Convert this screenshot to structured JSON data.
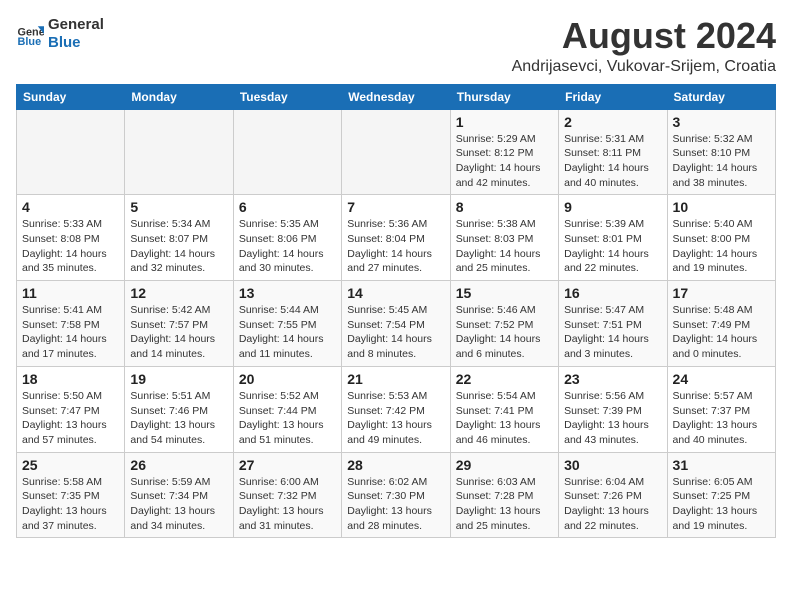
{
  "logo": {
    "line1": "General",
    "line2": "Blue"
  },
  "title": "August 2024",
  "subtitle": "Andrijasevci, Vukovar-Srijem, Croatia",
  "days_of_week": [
    "Sunday",
    "Monday",
    "Tuesday",
    "Wednesday",
    "Thursday",
    "Friday",
    "Saturday"
  ],
  "weeks": [
    [
      {
        "day": "",
        "info": ""
      },
      {
        "day": "",
        "info": ""
      },
      {
        "day": "",
        "info": ""
      },
      {
        "day": "",
        "info": ""
      },
      {
        "day": "1",
        "info": "Sunrise: 5:29 AM\nSunset: 8:12 PM\nDaylight: 14 hours\nand 42 minutes."
      },
      {
        "day": "2",
        "info": "Sunrise: 5:31 AM\nSunset: 8:11 PM\nDaylight: 14 hours\nand 40 minutes."
      },
      {
        "day": "3",
        "info": "Sunrise: 5:32 AM\nSunset: 8:10 PM\nDaylight: 14 hours\nand 38 minutes."
      }
    ],
    [
      {
        "day": "4",
        "info": "Sunrise: 5:33 AM\nSunset: 8:08 PM\nDaylight: 14 hours\nand 35 minutes."
      },
      {
        "day": "5",
        "info": "Sunrise: 5:34 AM\nSunset: 8:07 PM\nDaylight: 14 hours\nand 32 minutes."
      },
      {
        "day": "6",
        "info": "Sunrise: 5:35 AM\nSunset: 8:06 PM\nDaylight: 14 hours\nand 30 minutes."
      },
      {
        "day": "7",
        "info": "Sunrise: 5:36 AM\nSunset: 8:04 PM\nDaylight: 14 hours\nand 27 minutes."
      },
      {
        "day": "8",
        "info": "Sunrise: 5:38 AM\nSunset: 8:03 PM\nDaylight: 14 hours\nand 25 minutes."
      },
      {
        "day": "9",
        "info": "Sunrise: 5:39 AM\nSunset: 8:01 PM\nDaylight: 14 hours\nand 22 minutes."
      },
      {
        "day": "10",
        "info": "Sunrise: 5:40 AM\nSunset: 8:00 PM\nDaylight: 14 hours\nand 19 minutes."
      }
    ],
    [
      {
        "day": "11",
        "info": "Sunrise: 5:41 AM\nSunset: 7:58 PM\nDaylight: 14 hours\nand 17 minutes."
      },
      {
        "day": "12",
        "info": "Sunrise: 5:42 AM\nSunset: 7:57 PM\nDaylight: 14 hours\nand 14 minutes."
      },
      {
        "day": "13",
        "info": "Sunrise: 5:44 AM\nSunset: 7:55 PM\nDaylight: 14 hours\nand 11 minutes."
      },
      {
        "day": "14",
        "info": "Sunrise: 5:45 AM\nSunset: 7:54 PM\nDaylight: 14 hours\nand 8 minutes."
      },
      {
        "day": "15",
        "info": "Sunrise: 5:46 AM\nSunset: 7:52 PM\nDaylight: 14 hours\nand 6 minutes."
      },
      {
        "day": "16",
        "info": "Sunrise: 5:47 AM\nSunset: 7:51 PM\nDaylight: 14 hours\nand 3 minutes."
      },
      {
        "day": "17",
        "info": "Sunrise: 5:48 AM\nSunset: 7:49 PM\nDaylight: 14 hours\nand 0 minutes."
      }
    ],
    [
      {
        "day": "18",
        "info": "Sunrise: 5:50 AM\nSunset: 7:47 PM\nDaylight: 13 hours\nand 57 minutes."
      },
      {
        "day": "19",
        "info": "Sunrise: 5:51 AM\nSunset: 7:46 PM\nDaylight: 13 hours\nand 54 minutes."
      },
      {
        "day": "20",
        "info": "Sunrise: 5:52 AM\nSunset: 7:44 PM\nDaylight: 13 hours\nand 51 minutes."
      },
      {
        "day": "21",
        "info": "Sunrise: 5:53 AM\nSunset: 7:42 PM\nDaylight: 13 hours\nand 49 minutes."
      },
      {
        "day": "22",
        "info": "Sunrise: 5:54 AM\nSunset: 7:41 PM\nDaylight: 13 hours\nand 46 minutes."
      },
      {
        "day": "23",
        "info": "Sunrise: 5:56 AM\nSunset: 7:39 PM\nDaylight: 13 hours\nand 43 minutes."
      },
      {
        "day": "24",
        "info": "Sunrise: 5:57 AM\nSunset: 7:37 PM\nDaylight: 13 hours\nand 40 minutes."
      }
    ],
    [
      {
        "day": "25",
        "info": "Sunrise: 5:58 AM\nSunset: 7:35 PM\nDaylight: 13 hours\nand 37 minutes."
      },
      {
        "day": "26",
        "info": "Sunrise: 5:59 AM\nSunset: 7:34 PM\nDaylight: 13 hours\nand 34 minutes."
      },
      {
        "day": "27",
        "info": "Sunrise: 6:00 AM\nSunset: 7:32 PM\nDaylight: 13 hours\nand 31 minutes."
      },
      {
        "day": "28",
        "info": "Sunrise: 6:02 AM\nSunset: 7:30 PM\nDaylight: 13 hours\nand 28 minutes."
      },
      {
        "day": "29",
        "info": "Sunrise: 6:03 AM\nSunset: 7:28 PM\nDaylight: 13 hours\nand 25 minutes."
      },
      {
        "day": "30",
        "info": "Sunrise: 6:04 AM\nSunset: 7:26 PM\nDaylight: 13 hours\nand 22 minutes."
      },
      {
        "day": "31",
        "info": "Sunrise: 6:05 AM\nSunset: 7:25 PM\nDaylight: 13 hours\nand 19 minutes."
      }
    ]
  ]
}
